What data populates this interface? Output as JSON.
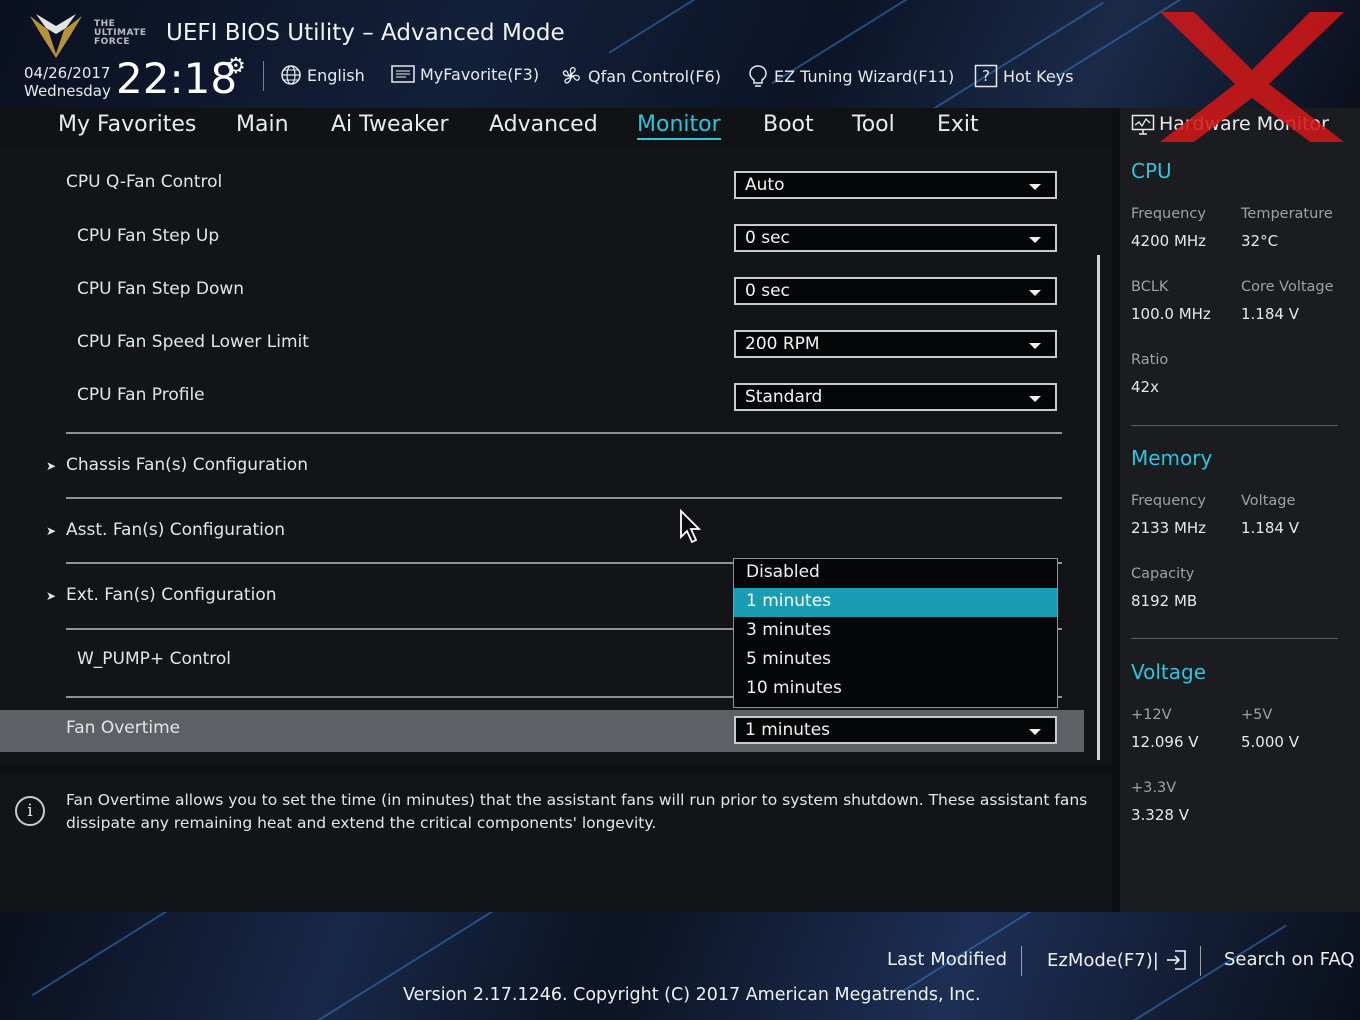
{
  "header": {
    "logo_text": "THE ULTIMATE FORCE",
    "title": "UEFI BIOS Utility – Advanced Mode",
    "date": "04/26/2017",
    "weekday": "Wednesday",
    "time": "22:18",
    "toolbar": [
      {
        "label": "English",
        "icon": "globe-icon"
      },
      {
        "label": "MyFavorite(F3)",
        "icon": "favorite-list-icon"
      },
      {
        "label": "Qfan Control(F6)",
        "icon": "fan-icon"
      },
      {
        "label": "EZ Tuning Wizard(F11)",
        "icon": "lightbulb-icon"
      },
      {
        "label": "Hot Keys",
        "icon": "question-box-icon"
      }
    ]
  },
  "nav": {
    "tabs": [
      "My Favorites",
      "Main",
      "Ai Tweaker",
      "Advanced",
      "Monitor",
      "Boot",
      "Tool",
      "Exit"
    ],
    "active": "Monitor"
  },
  "settings": {
    "cpu_qfan": {
      "label": "CPU Q-Fan Control",
      "value": "Auto"
    },
    "step_up": {
      "label": "CPU Fan Step Up",
      "value": "0 sec"
    },
    "step_down": {
      "label": "CPU Fan Step Down",
      "value": "0 sec"
    },
    "lower_limit": {
      "label": "CPU Fan Speed Lower Limit",
      "value": "200 RPM"
    },
    "profile": {
      "label": "CPU Fan Profile",
      "value": "Standard"
    },
    "chassis": {
      "label": "Chassis Fan(s) Configuration"
    },
    "asst": {
      "label": "Asst. Fan(s) Configuration"
    },
    "ext": {
      "label": "Ext. Fan(s) Configuration"
    },
    "wpump": {
      "label": "W_PUMP+ Control"
    },
    "overtime": {
      "label": "Fan Overtime",
      "value": "1 minutes"
    }
  },
  "dropdown": {
    "options": [
      "Disabled",
      "1 minutes",
      "3 minutes",
      "5 minutes",
      "10 minutes"
    ],
    "highlighted": "1 minutes"
  },
  "info": {
    "text": "Fan Overtime allows you to set the time (in minutes) that the assistant fans will run prior to system shutdown. These assistant fans dissipate any remaining heat and extend the critical components' longevity."
  },
  "hardware_monitor": {
    "title": "Hardware Monitor",
    "cpu": {
      "heading": "CPU",
      "frequency_label": "Frequency",
      "frequency": "4200 MHz",
      "temperature_label": "Temperature",
      "temperature": "32°C",
      "bclk_label": "BCLK",
      "bclk": "100.0 MHz",
      "core_voltage_label": "Core Voltage",
      "core_voltage": "1.184 V",
      "ratio_label": "Ratio",
      "ratio": "42x"
    },
    "memory": {
      "heading": "Memory",
      "frequency_label": "Frequency",
      "frequency": "2133 MHz",
      "voltage_label": "Voltage",
      "voltage": "1.184 V",
      "capacity_label": "Capacity",
      "capacity": "8192 MB"
    },
    "voltage": {
      "heading": "Voltage",
      "v12_label": "+12V",
      "v12": "12.096 V",
      "v5_label": "+5V",
      "v5": "5.000 V",
      "v33_label": "+3.3V",
      "v33": "3.328 V"
    }
  },
  "footer": {
    "last_modified": "Last Modified",
    "ezmode": "EzMode(F7)|",
    "search_faq": "Search on FAQ",
    "version": "Version 2.17.1246. Copyright (C) 2017 American Megatrends, Inc."
  },
  "colors": {
    "accent": "#2fc4dd",
    "highlight": "#1a9cb3",
    "watermark": "#d01818"
  }
}
